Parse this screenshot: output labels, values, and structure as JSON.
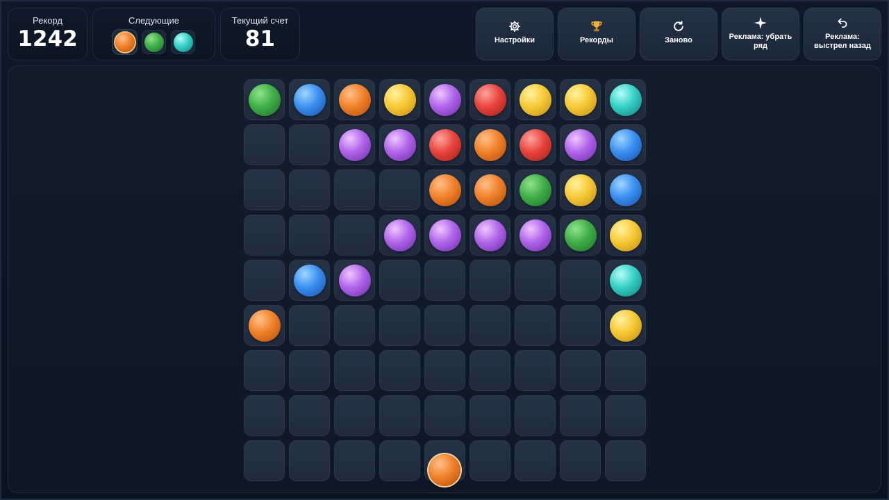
{
  "header": {
    "record": {
      "label": "Рекорд",
      "value": "1242"
    },
    "next": {
      "label": "Следующие",
      "balls": [
        "orange",
        "green",
        "cyan"
      ]
    },
    "score": {
      "label": "Текущий счет",
      "value": "81"
    },
    "buttons": [
      {
        "id": "settings",
        "icon": "gear-icon",
        "label": "Настройки"
      },
      {
        "id": "records",
        "icon": "trophy-icon",
        "label": "Рекорды"
      },
      {
        "id": "restart",
        "icon": "restart-icon",
        "label": "Заново"
      },
      {
        "id": "ad-remove-row",
        "icon": "sparkle-icon",
        "label": "Реклама: убрать ряд"
      },
      {
        "id": "ad-undo-shot",
        "icon": "undo-icon",
        "label": "Реклама: выстрел назад"
      }
    ]
  },
  "board": {
    "rows": [
      [
        "green",
        "blue",
        "orange",
        "yellow",
        "purple",
        "red",
        "yellow",
        "yellow",
        "cyan"
      ],
      [
        "",
        "",
        "purple",
        "purple",
        "red",
        "orange",
        "red",
        "purple",
        "blue"
      ],
      [
        "",
        "",
        "",
        "",
        "orange",
        "orange",
        "green",
        "yellow",
        "blue"
      ],
      [
        "",
        "",
        "",
        "purple",
        "purple",
        "purple",
        "purple",
        "green",
        "yellow"
      ],
      [
        "",
        "blue",
        "purple",
        "",
        "",
        "",
        "",
        "",
        "cyan"
      ],
      [
        "orange",
        "",
        "",
        "",
        "",
        "",
        "",
        "",
        "yellow"
      ],
      [
        "",
        "",
        "",
        "",
        "",
        "",
        "",
        "",
        ""
      ],
      [
        "",
        "",
        "",
        "",
        "",
        "",
        "",
        "",
        ""
      ],
      [
        "",
        "",
        "",
        "",
        "",
        "",
        "",
        "",
        ""
      ]
    ],
    "shooter_ball": "orange"
  },
  "colors": {
    "green": [
      "#8fe48a",
      "#3fae47",
      "#1f6e28"
    ],
    "blue": [
      "#9fd6ff",
      "#3a8ff0",
      "#1a4fa8"
    ],
    "orange": [
      "#ffc08a",
      "#f0812a",
      "#b24a0c"
    ],
    "yellow": [
      "#fff2a0",
      "#f6c936",
      "#c08a10"
    ],
    "purple": [
      "#f1c6ff",
      "#b064ea",
      "#6c2aa8"
    ],
    "red": [
      "#ffa3a0",
      "#e8443c",
      "#a01c18"
    ],
    "cyan": [
      "#b5fff6",
      "#34cfc6",
      "#127e7a"
    ]
  }
}
